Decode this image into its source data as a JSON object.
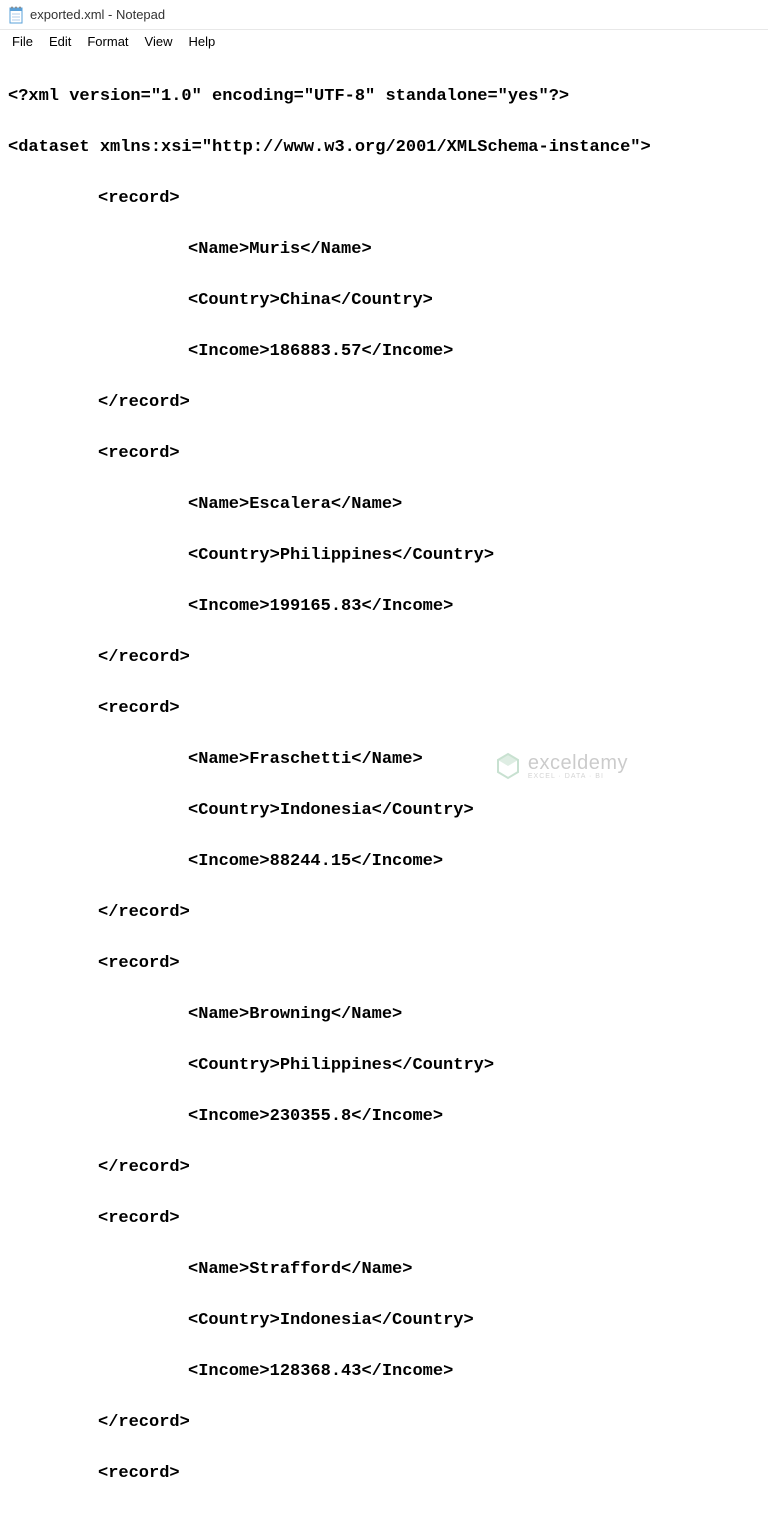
{
  "titleBar": {
    "title": "exported.xml - Notepad"
  },
  "menu": {
    "items": [
      "File",
      "Edit",
      "Format",
      "View",
      "Help"
    ]
  },
  "xml": {
    "declaration": "<?xml version=\"1.0\" encoding=\"UTF-8\" standalone=\"yes\"?>",
    "rootOpen": "<dataset xmlns:xsi=\"http://www.w3.org/2001/XMLSchema-instance\">",
    "recordOpen": "<record>",
    "recordClose": "</record>",
    "records": [
      {
        "name": "Muris",
        "country": "China",
        "income": "186883.57"
      },
      {
        "name": "Escalera",
        "country": "Philippines",
        "income": "199165.83"
      },
      {
        "name": "Fraschetti",
        "country": "Indonesia",
        "income": "88244.15"
      },
      {
        "name": "Browning",
        "country": "Philippines",
        "income": "230355.8"
      },
      {
        "name": "Strafford",
        "country": "Indonesia",
        "income": "128368.43"
      }
    ],
    "tags": {
      "nameOpen": "<Name>",
      "nameClose": "</Name>",
      "countryOpen": "<Country>",
      "countryClose": "</Country>",
      "incomeOpen": "<Income>",
      "incomeClose": "</Income>"
    }
  },
  "watermark": {
    "brand": "exceldemy",
    "tag": "EXCEL · DATA · BI"
  }
}
